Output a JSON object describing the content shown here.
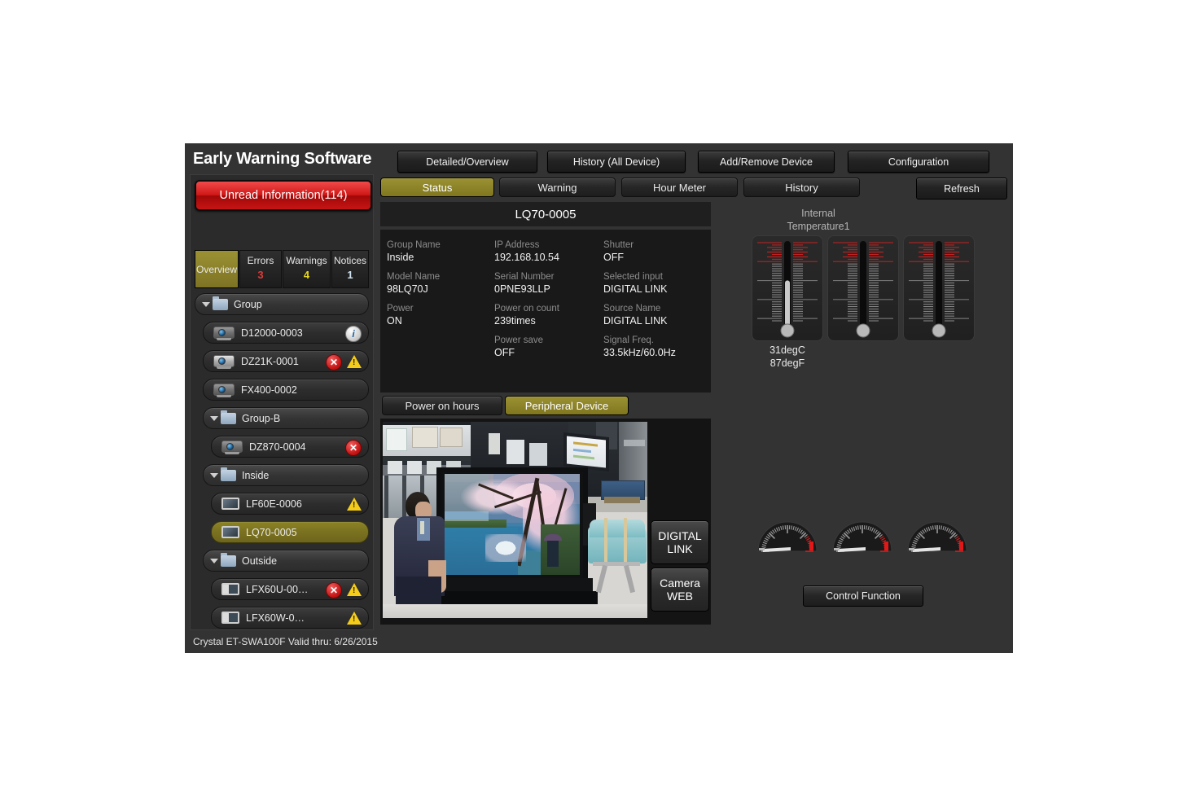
{
  "header": {
    "title": "Early Warning Software",
    "buttons": [
      {
        "label": "Detailed/Overview"
      },
      {
        "label": "History (All Device)"
      },
      {
        "label": "Add/Remove Device"
      },
      {
        "label": "Configuration"
      }
    ]
  },
  "sidebar": {
    "unread_label": "Unread Information(114)",
    "category_tabs": [
      {
        "label": "Overview",
        "count": "",
        "active": true
      },
      {
        "label": "Errors",
        "count": "3",
        "color": "#e03a3a"
      },
      {
        "label": "Warnings",
        "count": "4",
        "color": "#e8d820"
      },
      {
        "label": "Notices",
        "count": "1",
        "color": "#cfe0ef"
      }
    ],
    "tree": [
      {
        "type": "folder",
        "label": "Group",
        "indent": 0,
        "expanded": true
      },
      {
        "type": "projector",
        "label": "D12000-0003",
        "indent": 1,
        "badges": [
          "info"
        ]
      },
      {
        "type": "projector",
        "label": "DZ21K-0001",
        "indent": 1,
        "badges": [
          "error",
          "warning"
        ]
      },
      {
        "type": "projector",
        "label": "FX400-0002",
        "indent": 1,
        "badges": []
      },
      {
        "type": "folder",
        "label": "Group-B",
        "indent": 1,
        "expanded": true
      },
      {
        "type": "projector",
        "label": "DZ870-0004",
        "indent": 2,
        "badges": [
          "error"
        ]
      },
      {
        "type": "folder",
        "label": "Inside",
        "indent": 1,
        "expanded": true
      },
      {
        "type": "display",
        "label": "LF60E-0006",
        "indent": 2,
        "badges": [
          "warning"
        ]
      },
      {
        "type": "display",
        "label": "LQ70-0005",
        "indent": 2,
        "badges": [],
        "selected": true
      },
      {
        "type": "folder",
        "label": "Outside",
        "indent": 1,
        "expanded": true
      },
      {
        "type": "display-split",
        "label": "LFX60U-00…",
        "indent": 2,
        "badges": [
          "error",
          "warning"
        ]
      },
      {
        "type": "display-split",
        "label": "LFX60W-0…",
        "indent": 2,
        "badges": [
          "warning"
        ]
      }
    ]
  },
  "content": {
    "tabs": [
      {
        "label": "Status",
        "active": true
      },
      {
        "label": "Warning",
        "active": false
      },
      {
        "label": "Hour Meter",
        "active": false
      },
      {
        "label": "History",
        "active": false
      }
    ],
    "refresh_label": "Refresh",
    "device_title": "LQ70-0005",
    "status_fields": [
      {
        "key": "Group Name",
        "value": "Inside",
        "col": 0,
        "row": 0
      },
      {
        "key": "Model Name",
        "value": "98LQ70J",
        "col": 0,
        "row": 1
      },
      {
        "key": "Power",
        "value": "ON",
        "col": 0,
        "row": 2
      },
      {
        "key": "IP Address",
        "value": "192.168.10.54",
        "col": 1,
        "row": 0
      },
      {
        "key": "Serial Number",
        "value": "0PNE93LLP",
        "col": 1,
        "row": 1
      },
      {
        "key": "Power on count",
        "value": "239times",
        "col": 1,
        "row": 2
      },
      {
        "key": "Power save",
        "value": "OFF",
        "col": 1,
        "row": 3
      },
      {
        "key": "Shutter",
        "value": "OFF",
        "col": 2,
        "row": 0
      },
      {
        "key": "Selected input",
        "value": "DIGITAL LINK",
        "col": 2,
        "row": 1
      },
      {
        "key": "Source Name",
        "value": "DIGITAL LINK",
        "col": 2,
        "row": 2
      },
      {
        "key": "Signal Freq.",
        "value": "33.5kHz/60.0Hz",
        "col": 2,
        "row": 3
      }
    ],
    "sub_tabs": [
      {
        "label": "Power on hours",
        "active": false
      },
      {
        "label": "Peripheral Device",
        "active": true
      }
    ],
    "photo_buttons": [
      {
        "label": "DIGITAL\nLINK",
        "line1": "DIGITAL",
        "line2": "LINK"
      },
      {
        "label": "Camera\nWEB",
        "line1": "Camera",
        "line2": "WEB"
      }
    ],
    "temperature": {
      "label_line1": "Internal",
      "label_line2": "Temperature1",
      "readout_c": "31degC",
      "readout_f": "87degF",
      "gauges": [
        {
          "fill_pct": 58
        },
        {
          "fill_pct": 0
        },
        {
          "fill_pct": 0
        }
      ]
    },
    "control_function_label": "Control Function"
  },
  "footer": {
    "text": "Crystal  ET-SWA100F  Valid thru: 6/26/2015"
  },
  "colors": {
    "accent": "#8c8326",
    "error": "#c51414",
    "warning": "#f5cd18",
    "panel_bg": "#2b2b2b",
    "app_bg": "#333333"
  }
}
